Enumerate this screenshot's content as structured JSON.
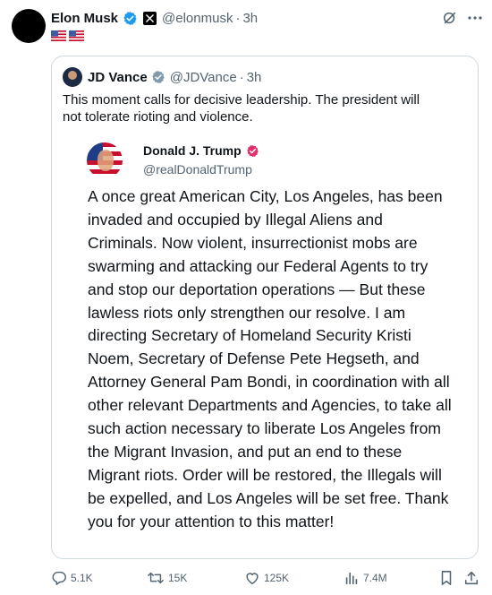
{
  "post": {
    "author_name": "Elon Musk",
    "author_handle": "@elonmusk",
    "separator": "·",
    "time": "3h",
    "flags": [
      "us-flag",
      "us-flag"
    ]
  },
  "quote": {
    "author_name": "JD Vance",
    "author_handle": "@JDVance",
    "separator": "·",
    "time": "3h",
    "text": "This moment calls for decisive leadership. The president will not tolerate rioting and violence."
  },
  "truth": {
    "author_name": "Donald J. Trump",
    "author_handle": "@realDonaldTrump",
    "text": "A once great American City, Los Angeles, has been invaded and occupied by Illegal Aliens and Criminals.  Now violent, insurrectionist mobs are swarming and attacking our Federal Agents to try and stop our deportation operations — But these lawless riots only strengthen our resolve. I am directing Secretary of Homeland Security Kristi Noem, Secretary of Defense Pete Hegseth, and Attorney General Pam Bondi, in coordination with all other relevant Departments and Agencies, to take all such action necessary to liberate Los Angeles from the Migrant Invasion, and put an end to these Migrant riots. Order will be restored, the Illegals will be expelled, and Los Angeles will be set free. Thank you for your attention to this matter!"
  },
  "actions": {
    "replies": "5.1K",
    "reposts": "15K",
    "likes": "125K",
    "views": "7.4M"
  },
  "colors": {
    "verified_blue": "#1d9bf0",
    "verified_gray": "#829aab",
    "truth_badge": "#e1306c",
    "muted_text": "#536471",
    "border": "#cfd9de"
  }
}
